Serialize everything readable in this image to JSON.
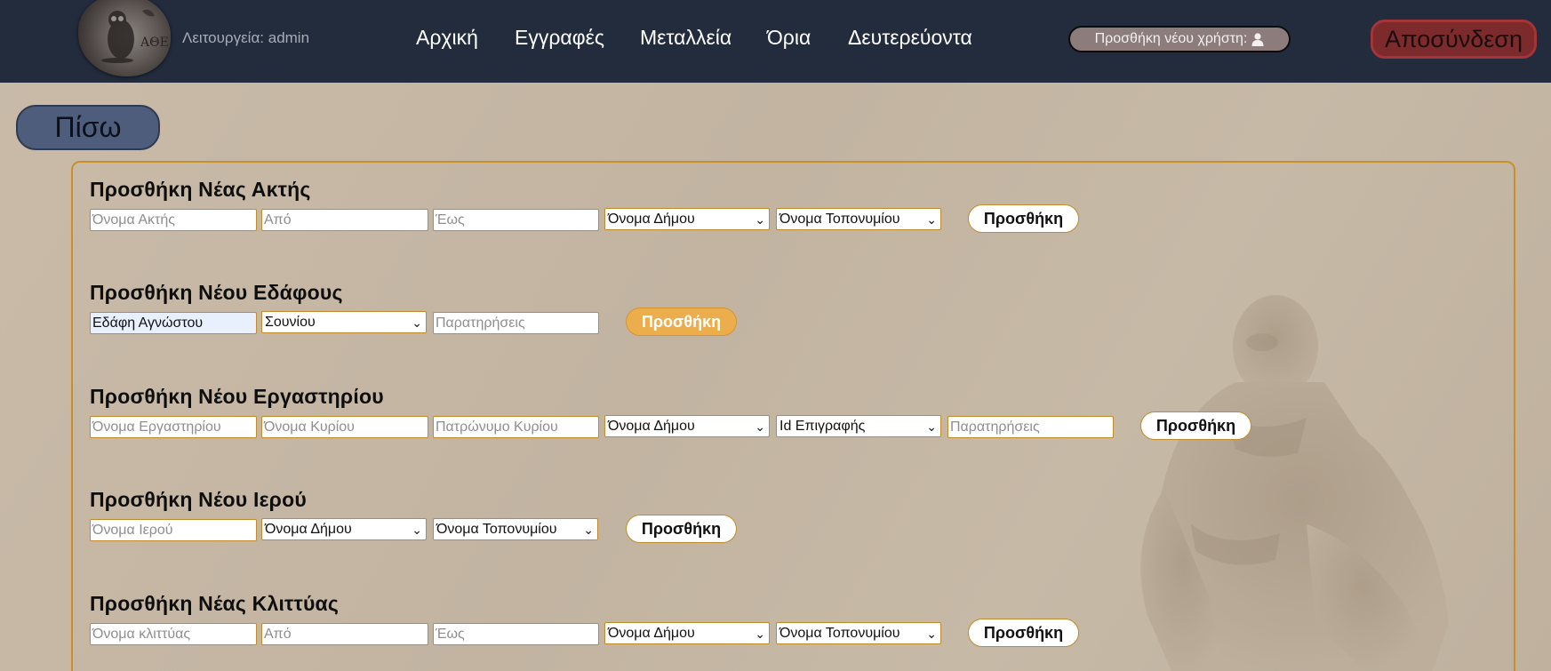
{
  "header": {
    "mode_label": "Λειτουργεία: admin",
    "nav": [
      "Αρχική",
      "Εγγραφές",
      "Μεταλλεία",
      "Όρια",
      "Δευτερεύοντα"
    ],
    "add_user_label": "Προσθήκη νέου χρήστη:",
    "logout_label": "Αποσύνδεση"
  },
  "back_label": "Πίσω",
  "sections": {
    "coast": {
      "title": "Προσθήκη Νέας Ακτής",
      "name_placeholder": "Όνομα Ακτής",
      "from_placeholder": "Από",
      "to_placeholder": "Έως",
      "municipality_select": "Όνομα Δήμου",
      "toponym_select": "Όνομα Τοπονυμίου",
      "button": "Προσθήκη"
    },
    "ground": {
      "title": "Προσθήκη Νέου Εδάφους",
      "name_value": "Εδάφη Αγνώστου",
      "region_select": "Σουνίου",
      "notes_placeholder": "Παρατηρήσεις",
      "button": "Προσθήκη"
    },
    "workshop": {
      "title": "Προσθήκη Νέου Εργαστηρίου",
      "name_placeholder": "Όνομα Εργαστηρίου",
      "owner_placeholder": "Όνομα Κυρίου",
      "patronym_placeholder": "Πατρώνυμο Κυρίου",
      "municipality_select": "Όνομα Δήμου",
      "inscription_select": "Id Επιγραφής",
      "notes_placeholder": "Παρατηρήσεις",
      "button": "Προσθήκη"
    },
    "temple": {
      "title": "Προσθήκη Νέου Ιερού",
      "name_placeholder": "Όνομα Ιερού",
      "municipality_select": "Όνομα Δήμου",
      "toponym_select": "Όνομα Τοπονυμίου",
      "button": "Προσθήκη"
    },
    "slope": {
      "title": "Προσθήκη Νέας Κλιττύας",
      "name_placeholder": "Όνομα κλιττύας",
      "from_placeholder": "Από",
      "to_placeholder": "Έως",
      "municipality_select": "Όνομα Δήμου",
      "toponym_select": "Όνομα Τοπονυμίου",
      "button": "Προσθήκη"
    }
  },
  "icons": {
    "select_arrow": "chevron-down-icon",
    "user": "user-icon",
    "logo": "owl-coin-logo",
    "statue": "boxer-statue"
  }
}
